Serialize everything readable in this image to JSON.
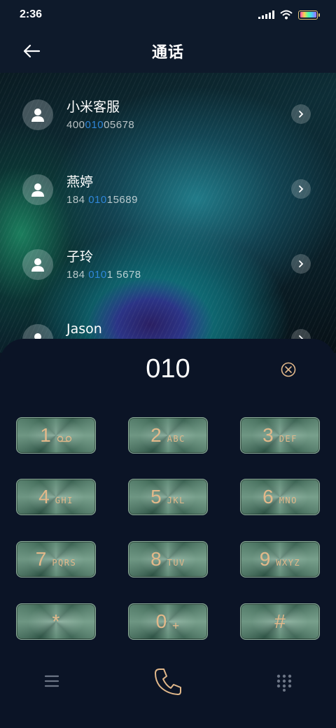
{
  "status_bar": {
    "time": "2:36"
  },
  "header": {
    "title": "通话"
  },
  "contacts": [
    {
      "name": "小米客服",
      "number_pre": "400",
      "number_hl": "010",
      "number_post": "05678"
    },
    {
      "name": "燕婷",
      "number_pre": "184 ",
      "number_hl": "010",
      "number_post": "15689"
    },
    {
      "name": "子玲",
      "number_pre": "184 ",
      "number_hl": "010",
      "number_post": "1 5678"
    },
    {
      "name": "Jason",
      "number_pre": "",
      "number_hl": "",
      "number_post": ""
    }
  ],
  "dialer": {
    "input": "010",
    "keys": [
      {
        "digit": "1",
        "letters": ""
      },
      {
        "digit": "2",
        "letters": "ABC"
      },
      {
        "digit": "3",
        "letters": "DEF"
      },
      {
        "digit": "4",
        "letters": "GHI"
      },
      {
        "digit": "5",
        "letters": "JKL"
      },
      {
        "digit": "6",
        "letters": "MNO"
      },
      {
        "digit": "7",
        "letters": "PQRS"
      },
      {
        "digit": "8",
        "letters": "TUV"
      },
      {
        "digit": "9",
        "letters": "WXYZ"
      },
      {
        "digit": "*",
        "letters": ""
      },
      {
        "digit": "0",
        "letters": "+"
      },
      {
        "digit": "#",
        "letters": ""
      }
    ]
  },
  "colors": {
    "accent": "#e2b88a",
    "highlight": "#2f86d8",
    "panel": "#0b1426"
  },
  "icons": [
    "back-arrow-icon",
    "person-icon",
    "chevron-right-icon",
    "clear-icon",
    "voicemail-icon",
    "menu-icon",
    "phone-icon",
    "keypad-icon"
  ]
}
